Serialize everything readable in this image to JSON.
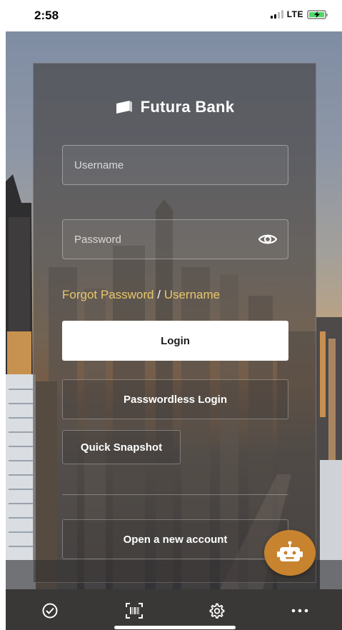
{
  "status_bar": {
    "time": "2:58",
    "network": "LTE",
    "battery_color": "#4cd964"
  },
  "brand": {
    "name": "Futura Bank",
    "logo_icon": "bank-logo-icon"
  },
  "login_form": {
    "username_placeholder": "Username",
    "password_placeholder": "Password",
    "show_password_icon": "eye-icon",
    "forgot_password_label": "Forgot Password",
    "forgot_separator": "/",
    "forgot_username_label": "Username",
    "login_label": "Login",
    "passwordless_label": "Passwordless Login",
    "quick_snapshot_label": "Quick Snapshot",
    "open_account_label": "Open a new account"
  },
  "chatbot": {
    "icon": "robot-icon",
    "color": "#c8832f"
  },
  "bottom_bar": {
    "tabs": [
      {
        "icon": "check-circle-icon"
      },
      {
        "icon": "barcode-scan-icon"
      },
      {
        "icon": "gear-icon"
      },
      {
        "icon": "more-dots-icon"
      }
    ]
  },
  "colors": {
    "accent": "#e9c76b",
    "card_overlay": "#3a3634",
    "bottom_bar": "#3a3837"
  }
}
